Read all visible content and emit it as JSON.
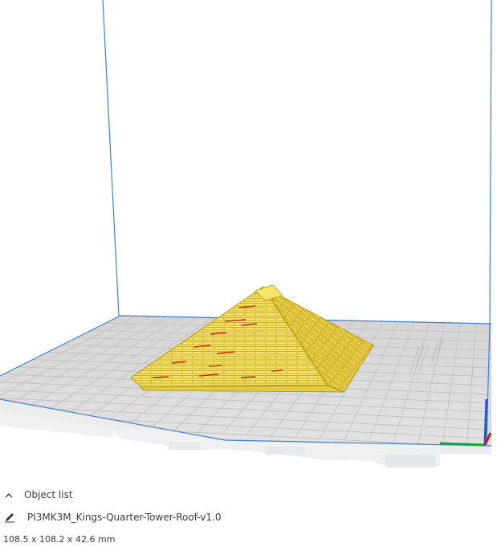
{
  "object_list": {
    "header_label": "Object list",
    "collapse_icon": "chevron-up-icon",
    "edit_icon": "pencil-icon",
    "object_name": "PI3MK3M_Kings-Quarter-Tower-Roof-v1.0",
    "dimensions": "108.5 x 108.2 x 42.6 mm"
  },
  "colors": {
    "model_fill": "#f2dc5a",
    "model_shadow": "#d8bf2c",
    "overhang_red": "#cf2a1a",
    "build_plate": "#d7d7d7",
    "grid_line": "#c2c2c2",
    "volume_edge": "#3a7fd5",
    "axis_x": "#c22020",
    "axis_y": "#19a33c",
    "axis_z": "#1f55d8"
  }
}
